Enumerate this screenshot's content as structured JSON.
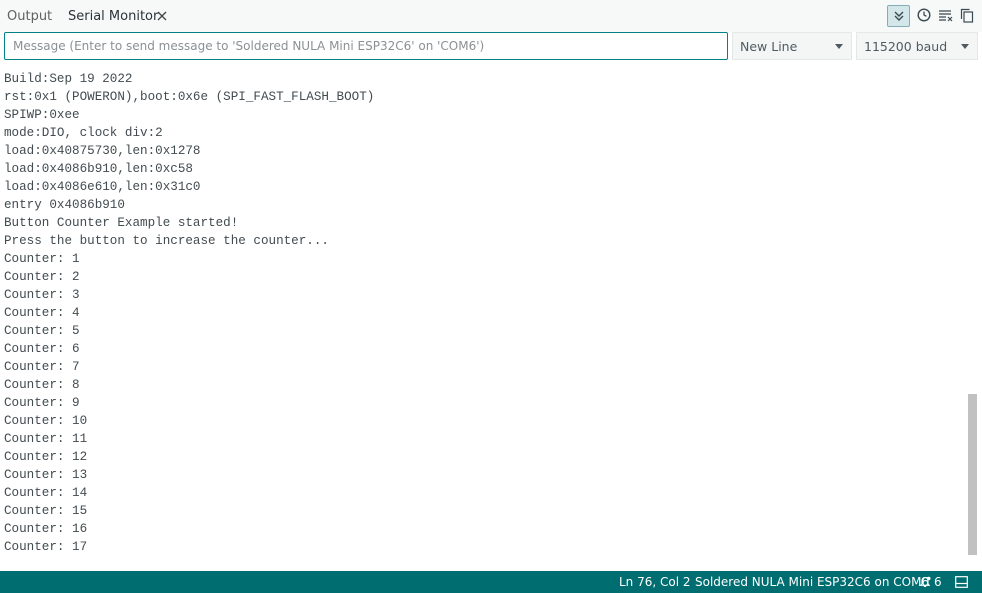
{
  "tabs": [
    {
      "label": "Output"
    },
    {
      "label": "Serial Monitor"
    }
  ],
  "toolbar": {
    "autoscroll_icon": "double-chevron-down-icon",
    "timestamp_icon": "clock-icon",
    "clear_icon": "clear-output-icon",
    "copy_icon": "copy-icon"
  },
  "message": {
    "value": "",
    "placeholder": "Message (Enter to send message to 'Soldered NULA Mini ESP32C6' on 'COM6')"
  },
  "line_ending": {
    "selected": "New Line"
  },
  "baud_rate": {
    "selected": "115200 baud"
  },
  "output_lines": [
    "Build:Sep 19 2022",
    "rst:0x1 (POWERON),boot:0x6e (SPI_FAST_FLASH_BOOT)",
    "SPIWP:0xee",
    "mode:DIO, clock div:2",
    "load:0x40875730,len:0x1278",
    "load:0x4086b910,len:0xc58",
    "load:0x4086e610,len:0x31c0",
    "entry 0x4086b910",
    "Button Counter Example started!",
    "Press the button to increase the counter...",
    "Counter: 1",
    "Counter: 2",
    "Counter: 3",
    "Counter: 4",
    "Counter: 5",
    "Counter: 6",
    "Counter: 7",
    "Counter: 8",
    "Counter: 9",
    "Counter: 10",
    "Counter: 11",
    "Counter: 12",
    "Counter: 13",
    "Counter: 14",
    "Counter: 15",
    "Counter: 16",
    "Counter: 17"
  ],
  "status": {
    "cursor": "Ln 76, Col 2",
    "board": "Soldered NULA Mini ESP32C6 on COM6",
    "notifications": "6"
  },
  "colors": {
    "accent": "#008184",
    "statusbar": "#006d70"
  }
}
